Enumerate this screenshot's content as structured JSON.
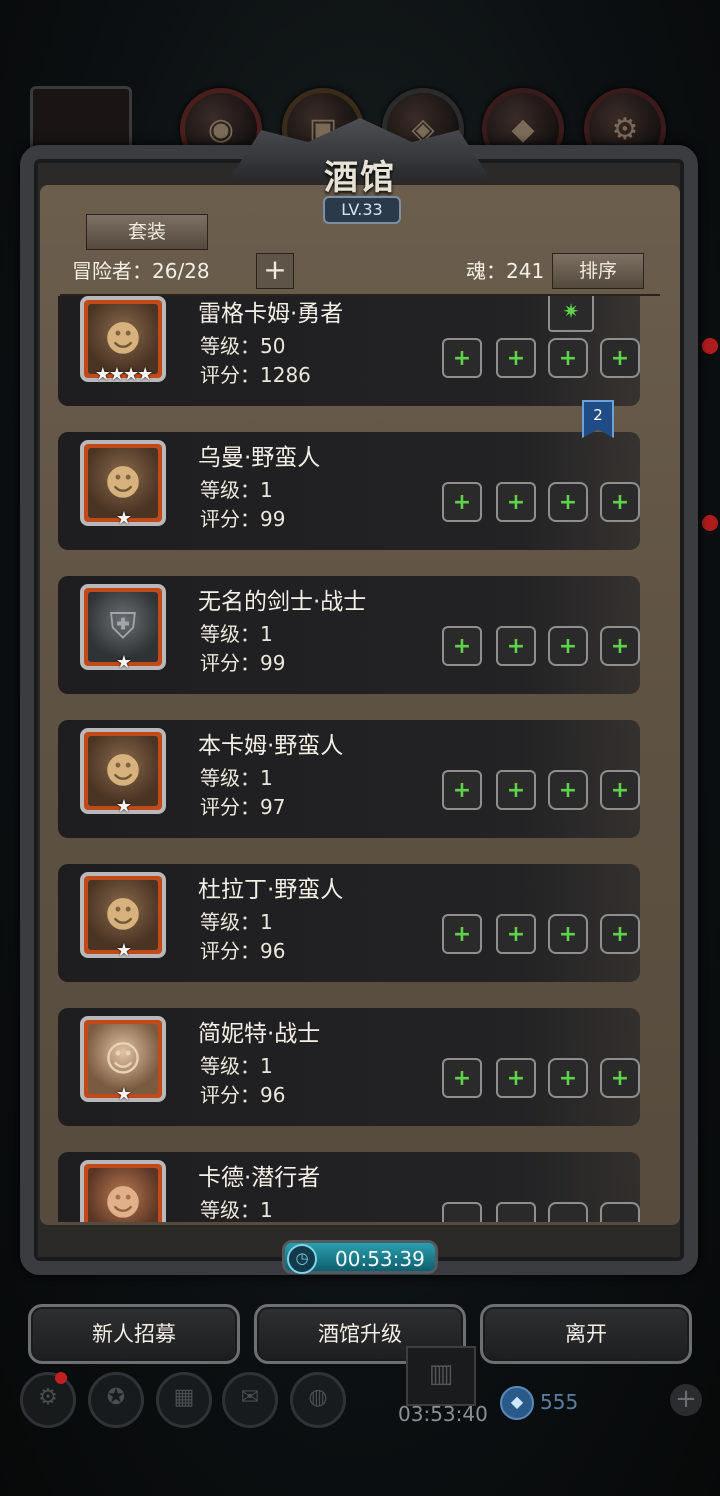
{
  "header": {
    "title": "酒馆",
    "level": "LV.33"
  },
  "toolbar": {
    "set_label": "套装",
    "adventurer_label": "冒险者：26/28",
    "add_label": "+",
    "soul_label": "魂：241",
    "sort_label": "排序"
  },
  "heroes": [
    {
      "name": "雷格卡姆·勇者",
      "level": "等级：50",
      "score": "评分：1286",
      "stars": "★★★★"
    },
    {
      "name": "乌曼·野蛮人",
      "level": "等级：1",
      "score": "评分：99",
      "stars": "★"
    },
    {
      "name": "无名的剑士·战士",
      "level": "等级：1",
      "score": "评分：99",
      "stars": "★"
    },
    {
      "name": "本卡姆·野蛮人",
      "level": "等级：1",
      "score": "评分：97",
      "stars": "★"
    },
    {
      "name": "杜拉丁·野蛮人",
      "level": "等级：1",
      "score": "评分：96",
      "stars": "★"
    },
    {
      "name": "简妮特·战士",
      "level": "等级：1",
      "score": "评分：96",
      "stars": "★"
    },
    {
      "name": "卡德·潜行者",
      "level": "等级：1",
      "score": "",
      "stars": ""
    }
  ],
  "bookmark": "2",
  "timer": "00:53:39",
  "buttons": {
    "recruit": "新人招募",
    "upgrade": "酒馆升级",
    "leave": "离开"
  },
  "hud": {
    "time": "03:53:40",
    "gems": "555"
  },
  "icons": {
    "slot": "plus-icon",
    "timer": "clock-icon"
  },
  "colors": {
    "accent_green": "#5fd14a",
    "portrait_border": "#c24a1a",
    "timer": "#2a9fae"
  }
}
